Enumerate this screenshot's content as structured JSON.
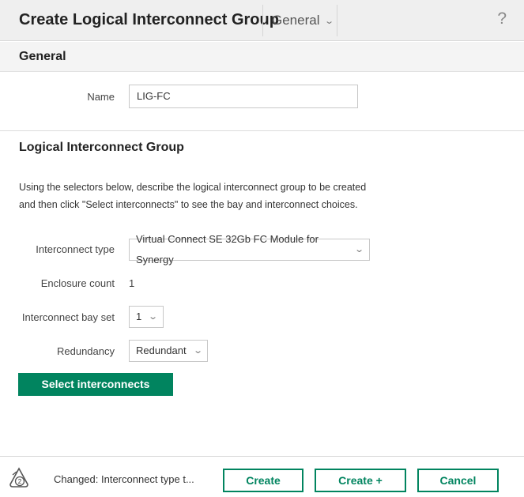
{
  "header": {
    "title": "Create Logical Interconnect Group",
    "view_selector": "General",
    "help": "?"
  },
  "general": {
    "title": "General",
    "name_label": "Name",
    "name_value": "LIG-FC"
  },
  "lig": {
    "title": "Logical Interconnect Group",
    "description": "Using the selectors below, describe the logical interconnect group to be created and then click \"Select interconnects\" to see the bay and interconnect choices.",
    "interconnect_type_label": "Interconnect type",
    "interconnect_type_value": "Virtual Connect SE 32Gb FC Module for Synergy",
    "enclosure_count_label": "Enclosure count",
    "enclosure_count_value": "1",
    "bay_set_label": "Interconnect bay set",
    "bay_set_value": "1",
    "redundancy_label": "Redundancy",
    "redundancy_value": "Redundant",
    "select_button": "Select interconnects"
  },
  "footer": {
    "changes_count": "2",
    "status": "Changed: Interconnect type t...",
    "create": "Create",
    "create_plus": "Create +",
    "cancel": "Cancel"
  },
  "colors": {
    "accent": "#01845f",
    "header_bg": "#efefef"
  }
}
